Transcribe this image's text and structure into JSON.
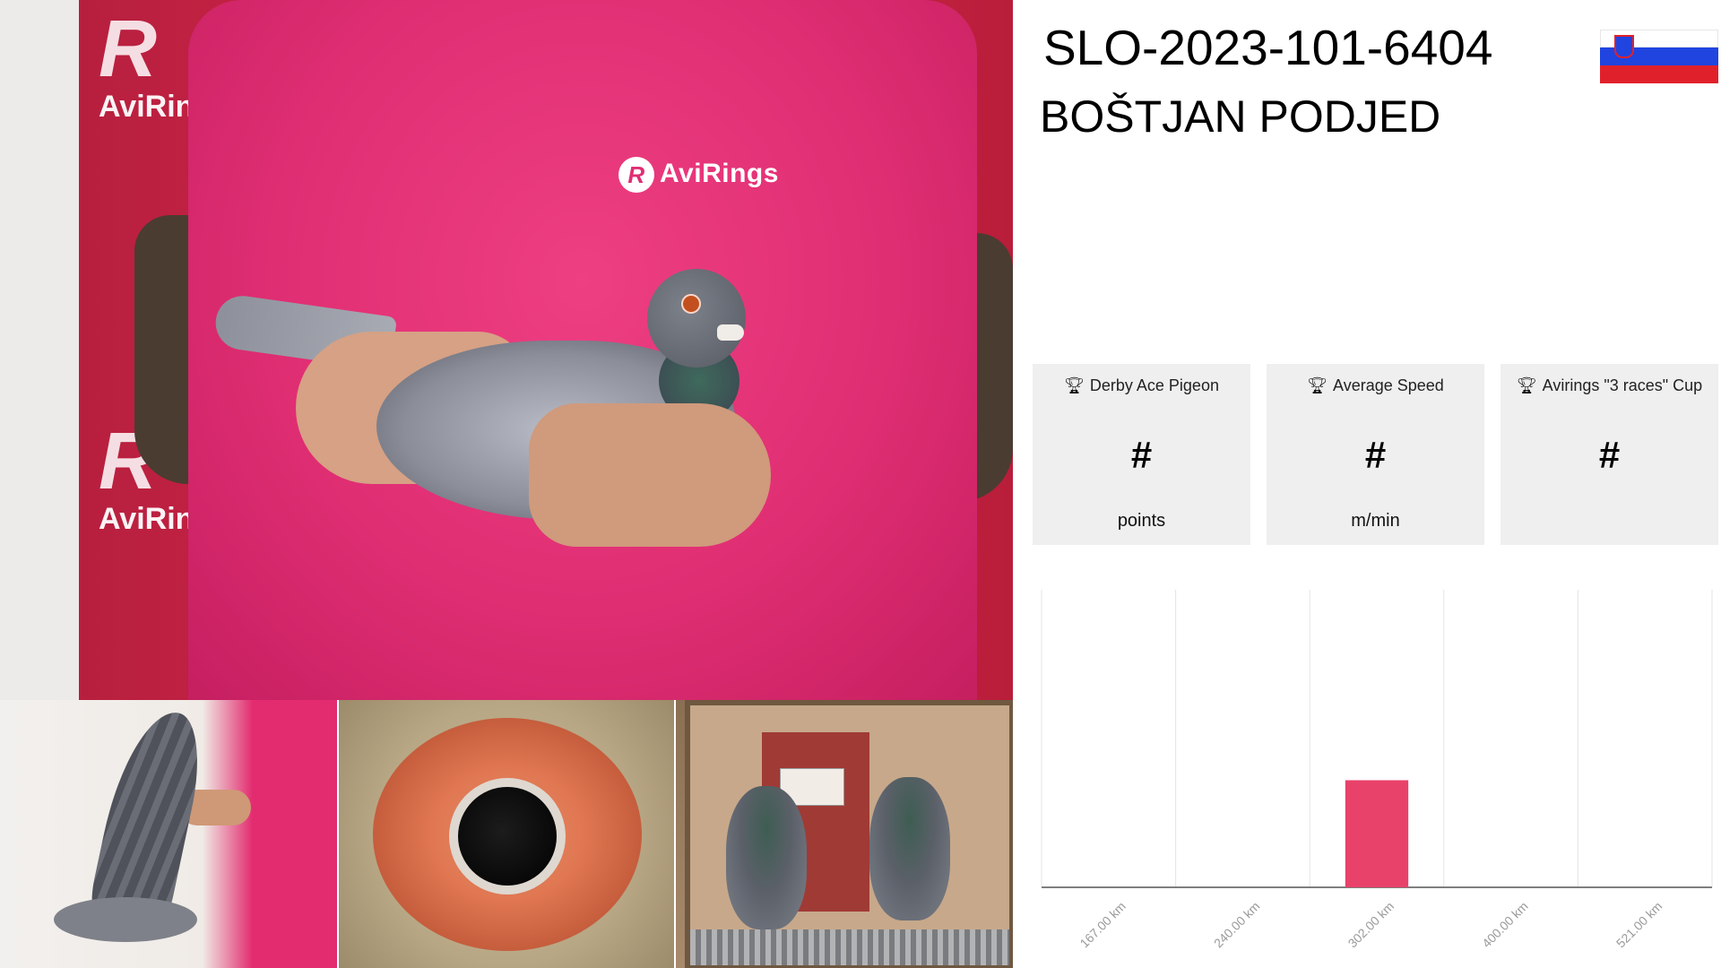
{
  "header": {
    "ring_number": "SLO-2023-101-6404",
    "owner": "BOŠTJAN PODJED"
  },
  "flag": {
    "country": "Slovenia",
    "colors": {
      "white": "#ffffff",
      "blue": "#1f44e0",
      "red": "#e0212b"
    }
  },
  "photos": {
    "main": {
      "shirt_logo": "AviRings",
      "banner_logo": "AviRings"
    }
  },
  "stats": [
    {
      "title": "Derby Ace Pigeon",
      "value": "#",
      "unit": "points",
      "icon": "trophy-icon"
    },
    {
      "title": "Average Speed",
      "value": "#",
      "unit": "m/min",
      "icon": "trophy-icon"
    },
    {
      "title": "Avirings \"3 races\" Cup",
      "value": "#",
      "unit": "",
      "icon": "trophy-icon"
    }
  ],
  "chart_data": {
    "type": "bar",
    "categories": [
      "167.00 km",
      "240.00 km",
      "302.00 km",
      "400.00 km",
      "521.00 km"
    ],
    "values": [
      0,
      0,
      0.36,
      0,
      0
    ],
    "ylim": [
      0,
      1
    ],
    "bar_color": "#e8416a",
    "grid": true,
    "title": "",
    "xlabel": "",
    "ylabel": ""
  }
}
